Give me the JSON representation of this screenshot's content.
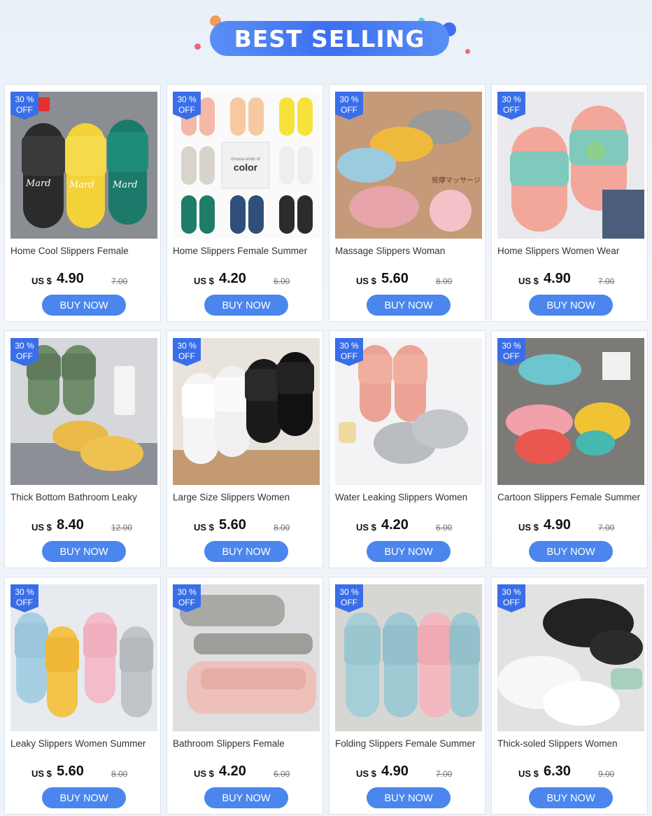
{
  "header": {
    "title": "BEST SELLING"
  },
  "products": [
    {
      "title": "Home Cool Slippers Female",
      "currency": "US $",
      "price": "4.90",
      "old_price": "7.00",
      "badge_line1": "30 %",
      "badge_line2": "OFF",
      "button": "BUY NOW",
      "img": "home-cool"
    },
    {
      "title": "Home Slippers Female Summer",
      "currency": "US $",
      "price": "4.20",
      "old_price": "6.00",
      "badge_line1": "30 %",
      "badge_line2": "OFF",
      "button": "BUY NOW",
      "img": "color-grid",
      "img_text": "choose kinds of",
      "img_word": "color"
    },
    {
      "title": "Massage Slippers Woman",
      "currency": "US $",
      "price": "5.60",
      "old_price": "8.00",
      "badge_line1": "30 %",
      "badge_line2": "OFF",
      "button": "BUY NOW",
      "img": "massage",
      "img_text": "按摩マッサージ"
    },
    {
      "title": "Home Slippers Women Wear",
      "currency": "US $",
      "price": "4.90",
      "old_price": "7.00",
      "badge_line1": "30 %",
      "badge_line2": "OFF",
      "button": "BUY NOW",
      "img": "dino"
    },
    {
      "title": "Thick Bottom Bathroom Leaky",
      "currency": "US $",
      "price": "8.40",
      "old_price": "12.00",
      "badge_line1": "30 %",
      "badge_line2": "OFF",
      "button": "BUY NOW",
      "img": "green-yellow"
    },
    {
      "title": "Large Size Slippers Women",
      "currency": "US $",
      "price": "5.60",
      "old_price": "8.00",
      "badge_line1": "30 %",
      "badge_line2": "OFF",
      "button": "BUY NOW",
      "img": "white-black"
    },
    {
      "title": "Water Leaking Slippers Women",
      "currency": "US $",
      "price": "4.20",
      "old_price": "6.00",
      "badge_line1": "30 %",
      "badge_line2": "OFF",
      "button": "BUY NOW",
      "img": "pink-gray"
    },
    {
      "title": "Cartoon Slippers Female Summer",
      "currency": "US $",
      "price": "4.90",
      "old_price": "7.00",
      "badge_line1": "30 %",
      "badge_line2": "OFF",
      "button": "BUY NOW",
      "img": "shark"
    },
    {
      "title": "Leaky Slippers Women Summer",
      "currency": "US $",
      "price": "5.60",
      "old_price": "8.00",
      "badge_line1": "30 %",
      "badge_line2": "OFF",
      "button": "BUY NOW",
      "img": "four-color"
    },
    {
      "title": "Bathroom Slippers Female",
      "currency": "US $",
      "price": "4.20",
      "old_price": "6.00",
      "badge_line1": "30 %",
      "badge_line2": "OFF",
      "button": "BUY NOW",
      "img": "pink-gray-stack"
    },
    {
      "title": "Folding Slippers Female Summer",
      "currency": "US $",
      "price": "4.90",
      "old_price": "7.00",
      "badge_line1": "30 %",
      "badge_line2": "OFF",
      "button": "BUY NOW",
      "img": "blue-pink"
    },
    {
      "title": "Thick-soled Slippers Women",
      "currency": "US $",
      "price": "6.30",
      "old_price": "9.00",
      "badge_line1": "30 %",
      "badge_line2": "OFF",
      "button": "BUY NOW",
      "img": "black-white"
    }
  ]
}
